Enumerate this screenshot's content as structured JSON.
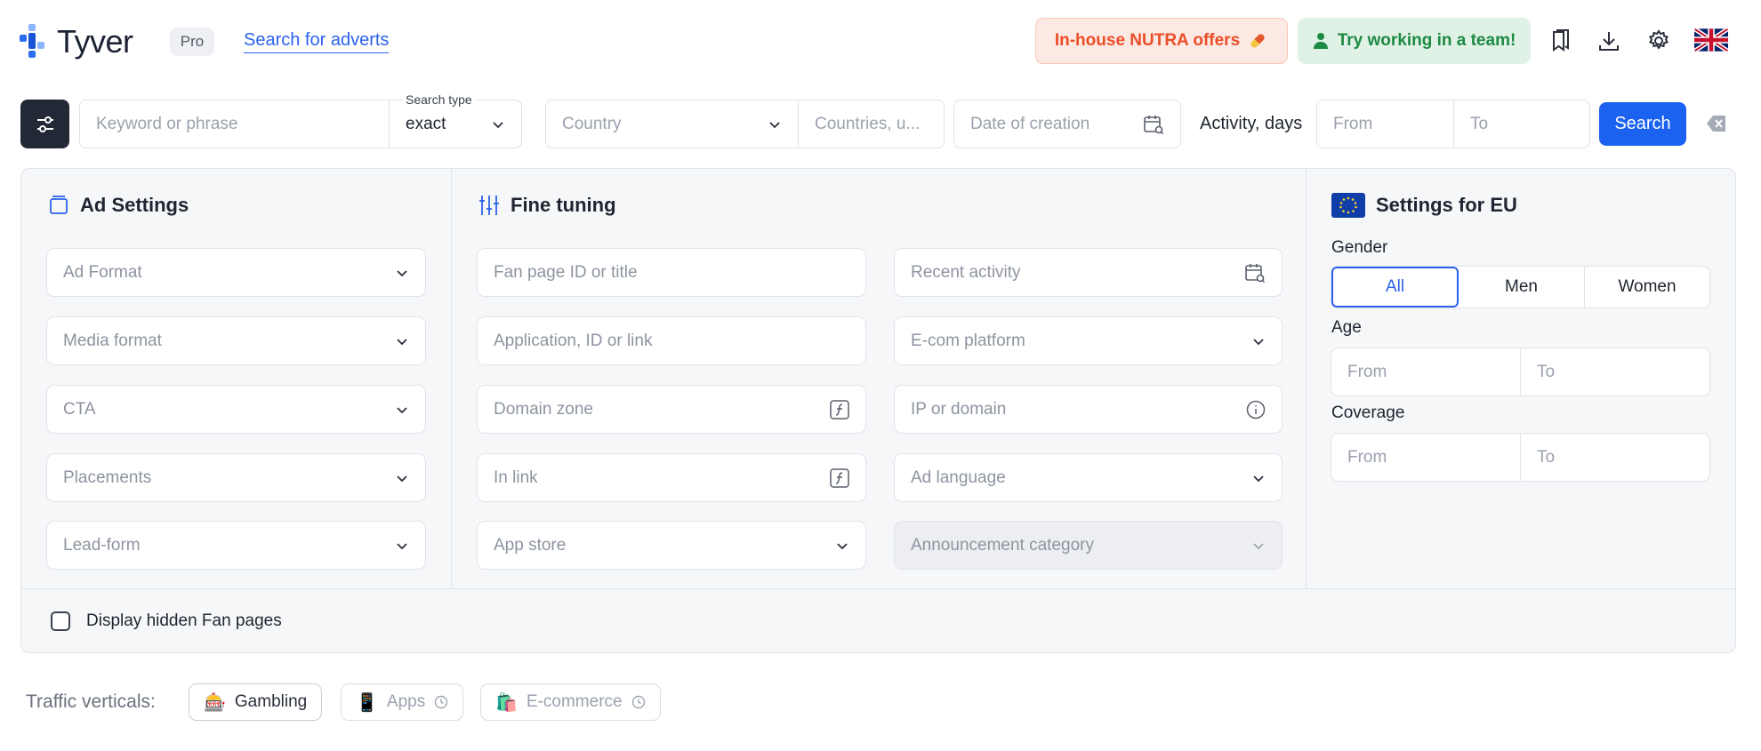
{
  "header": {
    "logo_text": "Tyver",
    "plan_badge": "Pro",
    "search_link": "Search for adverts",
    "nutra_offer": "In-house NUTRA offers",
    "team_offer": "Try working in a team!"
  },
  "search_bar": {
    "keyword_placeholder": "Keyword or phrase",
    "search_type_label": "Search type",
    "search_type_value": "exact",
    "country_placeholder": "Country",
    "countries_placeholder": "Countries, u...",
    "date_placeholder": "Date of creation",
    "activity_label": "Activity, days",
    "activity_from": "From",
    "activity_to": "To",
    "search_button": "Search"
  },
  "ad_settings": {
    "title": "Ad Settings",
    "fields": [
      "Ad Format",
      "Media format",
      "CTA",
      "Placements",
      "Lead-form"
    ]
  },
  "fine_tuning": {
    "title": "Fine tuning",
    "fan_page": "Fan page ID or title",
    "recent_activity": "Recent activity",
    "application": "Application, ID or link",
    "ecom_platform": "E-com platform",
    "domain_zone": "Domain zone",
    "ip_domain": "IP or domain",
    "in_link": "In link",
    "ad_language": "Ad language",
    "app_store": "App store",
    "announcement_category": "Announcement category"
  },
  "eu_settings": {
    "title": "Settings for EU",
    "gender_label": "Gender",
    "gender_options": [
      "All",
      "Men",
      "Women"
    ],
    "gender_selected": "All",
    "age_label": "Age",
    "age_from": "From",
    "age_to": "To",
    "coverage_label": "Coverage",
    "coverage_from": "From",
    "coverage_to": "To"
  },
  "hidden_pages": {
    "label": "Display hidden Fan pages",
    "checked": false
  },
  "traffic_verticals": {
    "label": "Traffic verticals:",
    "chips": [
      {
        "label": "Gambling",
        "active": true,
        "icon": "slot-machine-icon"
      },
      {
        "label": "Apps",
        "active": false,
        "icon": "phone-icon"
      },
      {
        "label": "E-commerce",
        "active": false,
        "icon": "shopping-bag-icon"
      }
    ]
  },
  "colors": {
    "accent": "#1c62f0",
    "nutra_text": "#ea4e28",
    "team_text": "#1d8a44",
    "dark_button": "#222836"
  }
}
